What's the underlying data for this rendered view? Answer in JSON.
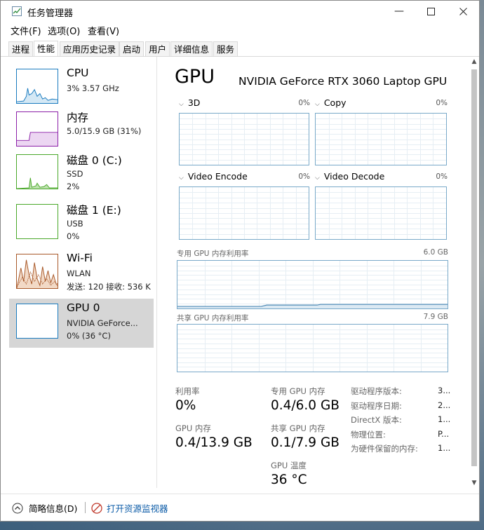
{
  "window": {
    "title": "任务管理器"
  },
  "menu": {
    "file": "文件(F)",
    "options": "选项(O)",
    "view": "查看(V)"
  },
  "tabs": [
    "进程",
    "性能",
    "应用历史记录",
    "启动",
    "用户",
    "详细信息",
    "服务"
  ],
  "sidebar": {
    "cpu": {
      "title": "CPU",
      "line1": "3% 3.57 GHz"
    },
    "memory": {
      "title": "内存",
      "line1": "5.0/15.9 GB (31%)"
    },
    "disk0": {
      "title": "磁盘 0 (C:)",
      "line1": "SSD",
      "line2": "2%"
    },
    "disk1": {
      "title": "磁盘 1 (E:)",
      "line1": "USB",
      "line2": "0%"
    },
    "wifi": {
      "title": "Wi-Fi",
      "line1": "WLAN",
      "line2": "发送: 120 接收: 536 K"
    },
    "gpu": {
      "title": "GPU 0",
      "line1": "NVIDIA GeForce...",
      "line2": "0% (36 °C)"
    }
  },
  "gpu": {
    "title": "GPU",
    "name": "NVIDIA GeForce RTX 3060 Laptop GPU",
    "engines": [
      {
        "label": "3D",
        "pct": "0%"
      },
      {
        "label": "Copy",
        "pct": "0%"
      },
      {
        "label": "Video Encode",
        "pct": "0%"
      },
      {
        "label": "Video Decode",
        "pct": "0%"
      }
    ],
    "dedicated_graph": {
      "label": "专用 GPU 内存利用率",
      "max": "6.0 GB"
    },
    "shared_graph": {
      "label": "共享 GPU 内存利用率",
      "max": "7.9 GB"
    },
    "stats": {
      "utilization": {
        "label": "利用率",
        "value": "0%"
      },
      "dedicated": {
        "label": "专用 GPU 内存",
        "value": "0.4/6.0 GB"
      },
      "gpu_memory": {
        "label": "GPU 内存",
        "value": "0.4/13.9 GB"
      },
      "shared": {
        "label": "共享 GPU 内存",
        "value": "0.1/7.9 GB"
      },
      "temperature": {
        "label": "GPU 温度",
        "value": "36 °C"
      }
    },
    "info": [
      {
        "label": "驱动程序版本:",
        "value": "3..."
      },
      {
        "label": "驱动程序日期:",
        "value": "2..."
      },
      {
        "label": "DirectX 版本:",
        "value": "1..."
      },
      {
        "label": "物理位置:",
        "value": "P..."
      },
      {
        "label": "为硬件保留的内存:",
        "value": "1..."
      }
    ]
  },
  "footer": {
    "less_details": "简略信息(D)",
    "resource_monitor": "打开资源监视器"
  },
  "colors": {
    "cpu": "#1a7bbf",
    "memory": "#8b1fa8",
    "disk": "#4aa82a",
    "wifi": "#a8592a",
    "gpu": "#1a7bbf",
    "graph_border": "#79a9c9"
  }
}
